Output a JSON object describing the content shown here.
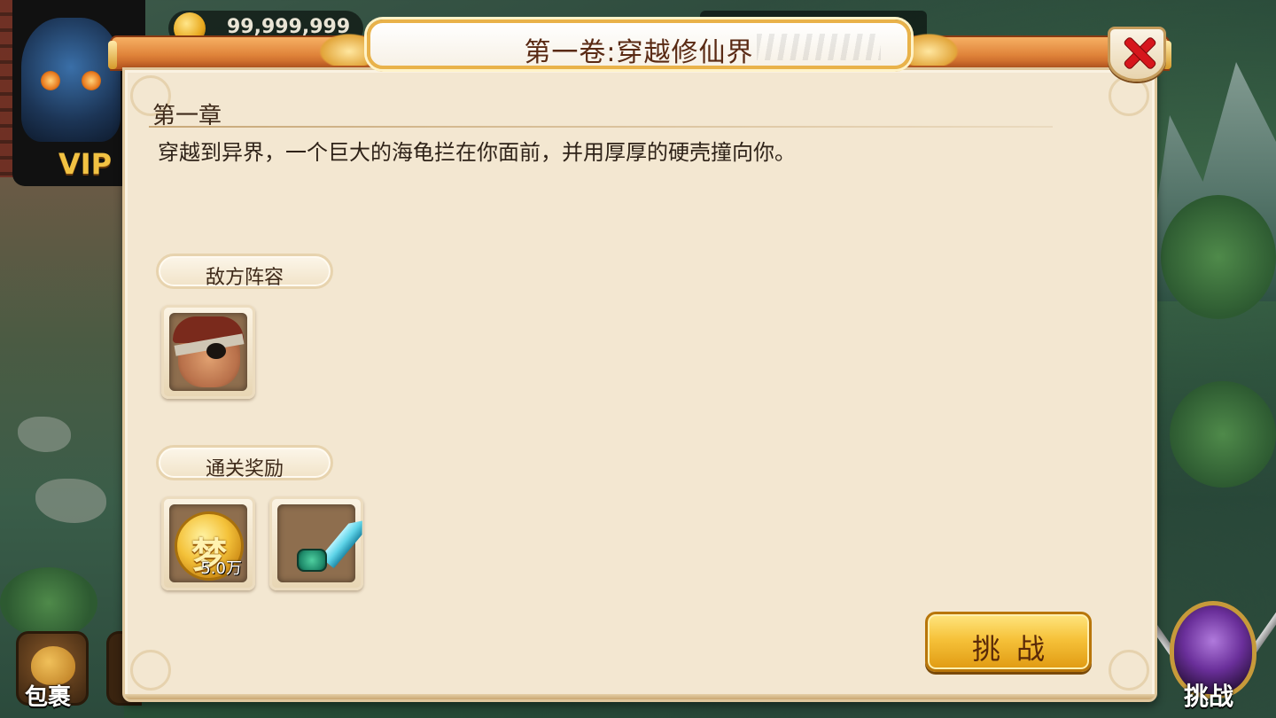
{
  "hud": {
    "currency_value": "99,999,999",
    "vip_label": "VIP"
  },
  "dialog": {
    "title": "第一卷:穿越修仙界",
    "chapter_label": "第一章",
    "chapter_description": "穿越到异界，一个巨大的海龟拦在你面前，并用厚厚的硬壳撞向你。",
    "enemy_section_label": "敌方阵容",
    "reward_section_label": "通关奖励",
    "rewards": [
      {
        "icon": "dream-coin-icon",
        "glyph": "梦",
        "amount": "5.0万"
      },
      {
        "icon": "jade-sword-icon"
      }
    ],
    "challenge_button_label": "挑战"
  },
  "bottom_bar": {
    "bag_label": "包裹",
    "challenge_label": "挑战"
  },
  "colors": {
    "title_text": "#5a2a14",
    "panel_background": "#f3e7d1",
    "header_orange": "#e0843a",
    "close_red": "#d6161c",
    "button_gold": "#f6c23a"
  }
}
